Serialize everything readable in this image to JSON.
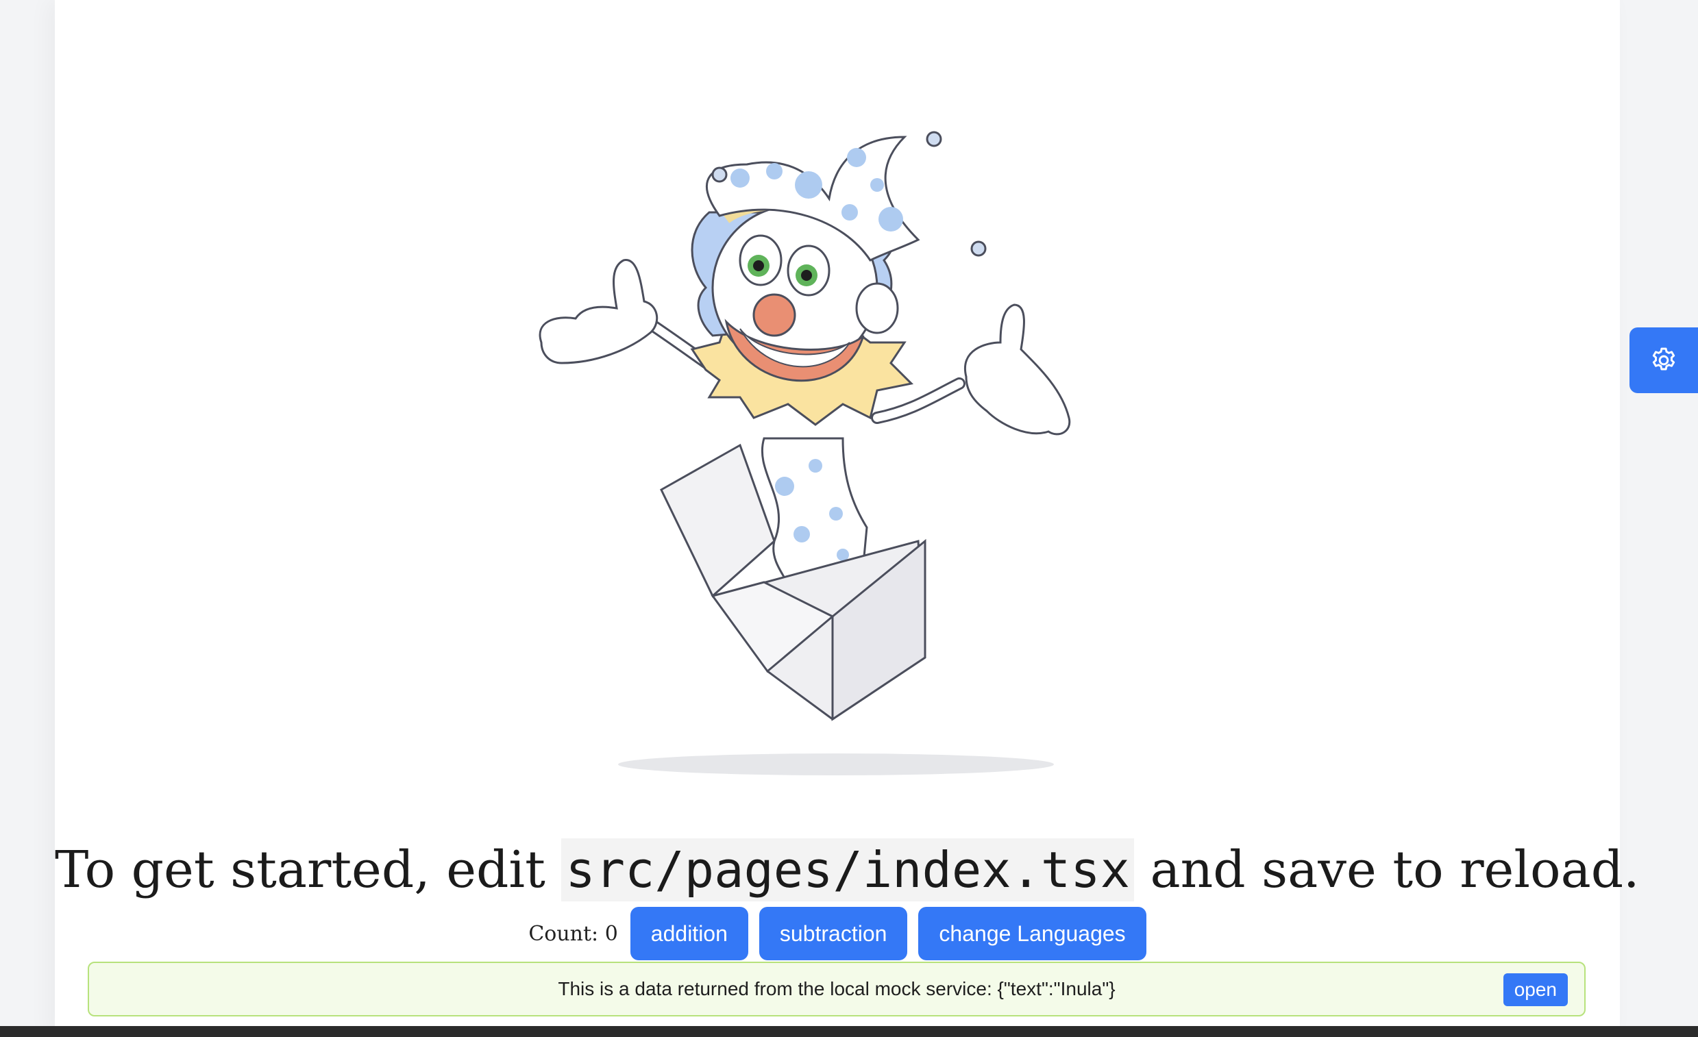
{
  "headline": {
    "before": "To get started, edit ",
    "code": "src/pages/index.tsx",
    "after": " and save to reload."
  },
  "counter": {
    "label": "Count:",
    "value": "0"
  },
  "buttons": {
    "addition": "addition",
    "subtraction": "subtraction",
    "change_languages": "change Languages"
  },
  "alert": {
    "message": "This is a data returned from the local mock service: {\"text\":\"Inula\"}",
    "open_label": "open",
    "color": "#b7e27c"
  },
  "settings": {
    "icon": "gear-icon",
    "color": "#3478f6"
  },
  "illustration": {
    "subject": "jester-in-the-box"
  }
}
